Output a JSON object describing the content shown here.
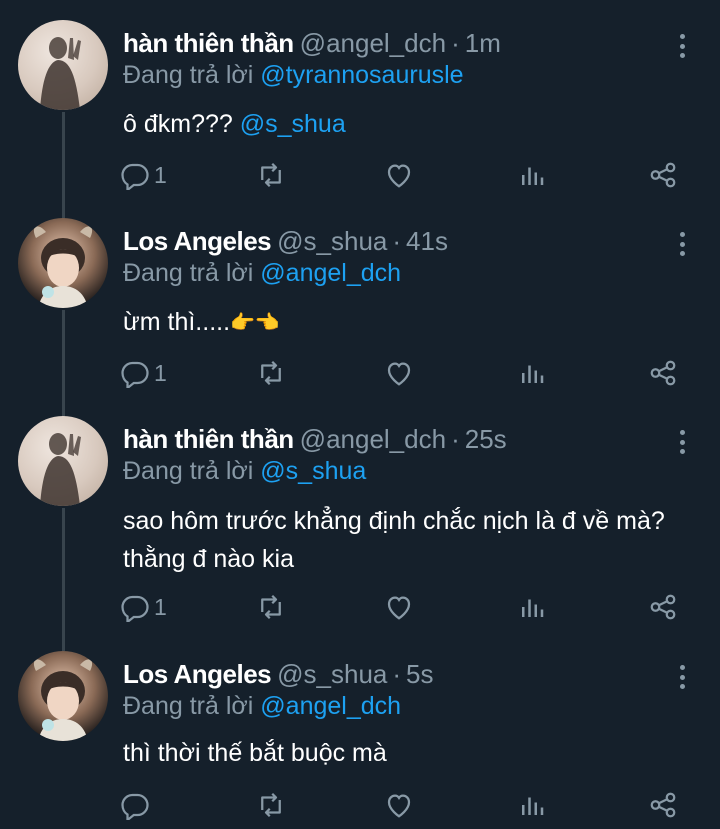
{
  "tweets": [
    {
      "name": "hàn thiên thần",
      "handle": "@angel_dch",
      "sep": "·",
      "time": "1m",
      "replying_prefix": "Đang trả lời",
      "replying_to": "@tyrannosaurusle",
      "text": "ô đkm???",
      "text_mention": "@s_shua",
      "reply_count": "1"
    },
    {
      "name": "Los Angeles",
      "handle": "@s_shua",
      "sep": "·",
      "time": "41s",
      "replying_prefix": "Đang trả lời",
      "replying_to": "@angel_dch",
      "text": "ừm thì.....",
      "emoji": "👉👈",
      "reply_count": "1"
    },
    {
      "name": "hàn thiên thần",
      "handle": "@angel_dch",
      "sep": "·",
      "time": "25s",
      "replying_prefix": "Đang trả lời",
      "replying_to": "@s_shua",
      "text_line1": "sao hôm trước khẳng định chắc nịch là đ về mà?",
      "text_line2": "thằng đ nào kia",
      "reply_count": "1"
    },
    {
      "name": "Los Angeles",
      "handle": "@s_shua",
      "sep": "·",
      "time": "5s",
      "replying_prefix": "Đang trả lời",
      "replying_to": "@angel_dch",
      "text": "thì thời thế bắt buộc mà",
      "reply_count": ""
    }
  ],
  "colors": {
    "background": "#15202b",
    "secondary_text": "#8899a6",
    "link": "#1da1f2",
    "thread_line": "#38444d"
  },
  "icons": [
    "reply-icon",
    "retweet-icon",
    "like-icon",
    "analytics-icon",
    "share-icon",
    "more-icon"
  ]
}
